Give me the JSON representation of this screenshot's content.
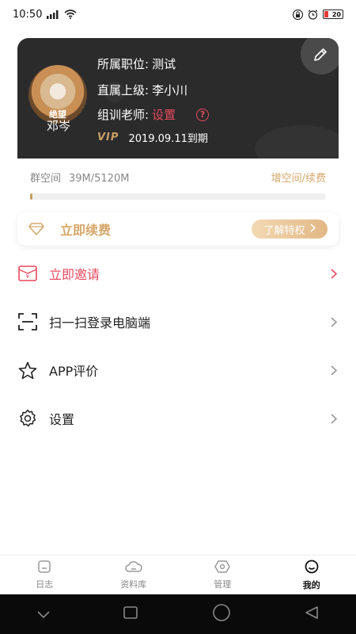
{
  "status_bar": {
    "time": "10:50",
    "battery": "20"
  },
  "profile": {
    "avatar_caption": "绝望",
    "name": "邓岑",
    "position_label": "所属职位:",
    "position_value": "测试",
    "supervisor_label": "直属上级:",
    "supervisor_value": "李小川",
    "trainer_label": "组训老师:",
    "trainer_value": "设置",
    "vip_badge": "VIP",
    "vip_expiry": "2019.09.11到期"
  },
  "storage": {
    "label": "群空间",
    "usage": "39M/5120M",
    "used_fraction": 0.0076,
    "link": "增空间/续费"
  },
  "renew": {
    "label": "立即续费",
    "button": "了解特权"
  },
  "menu": {
    "invite": "立即邀请",
    "scan": "扫一扫登录电脑端",
    "rate": "APP评价",
    "settings": "设置"
  },
  "tabs": [
    {
      "label": "日志",
      "icon": "journal-icon"
    },
    {
      "label": "资料库",
      "icon": "cloud-icon"
    },
    {
      "label": "管理",
      "icon": "hexagon-icon"
    },
    {
      "label": "我的",
      "icon": "profile-icon"
    }
  ],
  "colors": {
    "accent_red": "#e84a5f",
    "gold": "#d6a76a",
    "card_dark": "#2b2b2c"
  }
}
